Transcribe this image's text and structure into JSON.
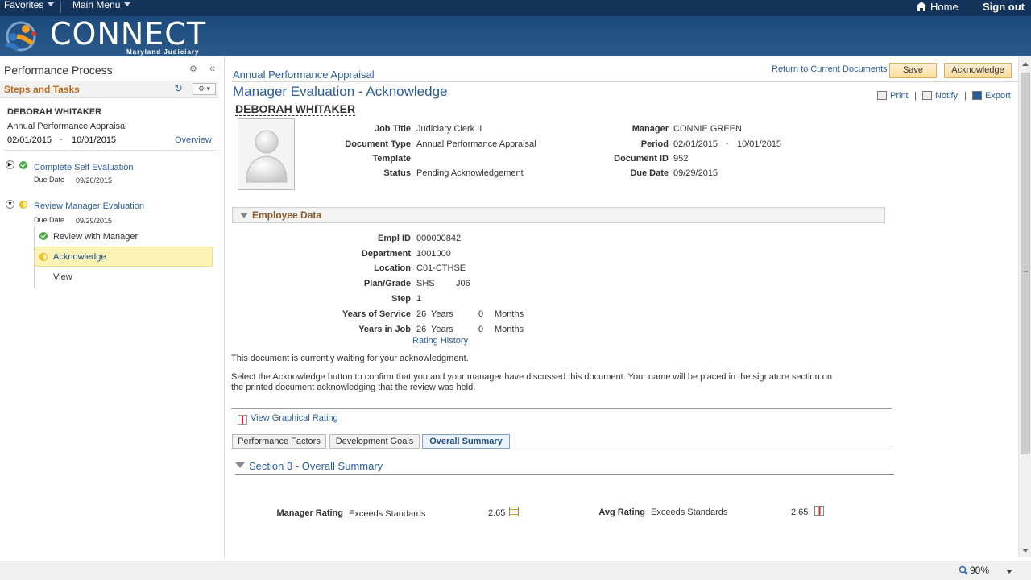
{
  "topbar": {
    "favorites": "Favorites",
    "main_menu": "Main Menu",
    "home": "Home",
    "sign_out": "Sign out"
  },
  "banner": {
    "logo_text": "CONNECT",
    "logo_sub": "Maryland Judiciary"
  },
  "left": {
    "title": "Performance Process",
    "steps_header": "Steps and Tasks",
    "employee": "DEBORAH WHITAKER",
    "document": "Annual Performance Appraisal",
    "start_date": "02/01/2015",
    "dash": "-",
    "end_date": "10/01/2015",
    "overview": "Overview",
    "steps": [
      {
        "label": "Complete Self Evaluation",
        "due_label": "Due Date",
        "due": "09/26/2015",
        "status": "complete"
      },
      {
        "label": "Review Manager Evaluation",
        "due_label": "Due Date",
        "due": "09/29/2015",
        "status": "in-progress"
      }
    ],
    "subitems": [
      {
        "label": "Review with Manager",
        "status": "complete"
      },
      {
        "label": "Acknowledge",
        "status": "in-progress"
      },
      {
        "label": "View"
      }
    ]
  },
  "main": {
    "breadcrumb": "Annual Performance Appraisal",
    "return_link": "Return to Current Documents",
    "save": "Save",
    "acknowledge": "Acknowledge",
    "title": "Manager Evaluation - Acknowledge",
    "actions": {
      "print": "Print",
      "notify": "Notify",
      "export": "Export"
    },
    "employee_name": "DEBORAH WHITAKER",
    "header_fields": {
      "job_title_label": "Job Title",
      "job_title": "Judiciary Clerk II",
      "doc_type_label": "Document Type",
      "doc_type": "Annual Performance Appraisal",
      "template_label": "Template",
      "template": "",
      "status_label": "Status",
      "status": "Pending Acknowledgement",
      "manager_label": "Manager",
      "manager": "CONNIE GREEN",
      "period_label": "Period",
      "period_start": "02/01/2015",
      "period_dash": "-",
      "period_end": "10/01/2015",
      "doc_id_label": "Document ID",
      "doc_id": "952",
      "due_date_label": "Due Date",
      "due_date": "09/29/2015"
    },
    "employee_data": {
      "header": "Employee Data",
      "empl_id_label": "Empl ID",
      "empl_id": "000000842",
      "dept_label": "Department",
      "dept": "1001000",
      "location_label": "Location",
      "location": "C01-CTHSE",
      "plan_label": "Plan/Grade",
      "plan": "SHS",
      "grade": "J06",
      "step_label": "Step",
      "step": "1",
      "yos_label": "Years of Service",
      "yos_years": "26",
      "yos_years_unit": "Years",
      "yos_months": "0",
      "yos_months_unit": "Months",
      "yij_label": "Years in Job",
      "yij_years": "26",
      "yij_years_unit": "Years",
      "yij_months": "0",
      "yij_months_unit": "Months",
      "rating_history": "Rating History"
    },
    "message1": "This document is currently waiting for your acknowledgment.",
    "message2": "Select the Acknowledge button to confirm that you and your manager have discussed this document. Your name will be placed in the signature section on the printed document acknowledging that the review was held.",
    "graph_link": "View Graphical Rating",
    "tabs": [
      "Performance Factors",
      "Development Goals",
      "Overall Summary"
    ],
    "section_title": "Section 3 - Overall Summary",
    "summary": {
      "manager_rating_label": "Manager Rating",
      "manager_rating": "Exceeds Standards",
      "manager_score": "2.65",
      "avg_rating_label": "Avg Rating",
      "avg_rating": "Exceeds Standards",
      "avg_score": "2.65"
    }
  },
  "statusbar": {
    "zoom": "90%"
  }
}
